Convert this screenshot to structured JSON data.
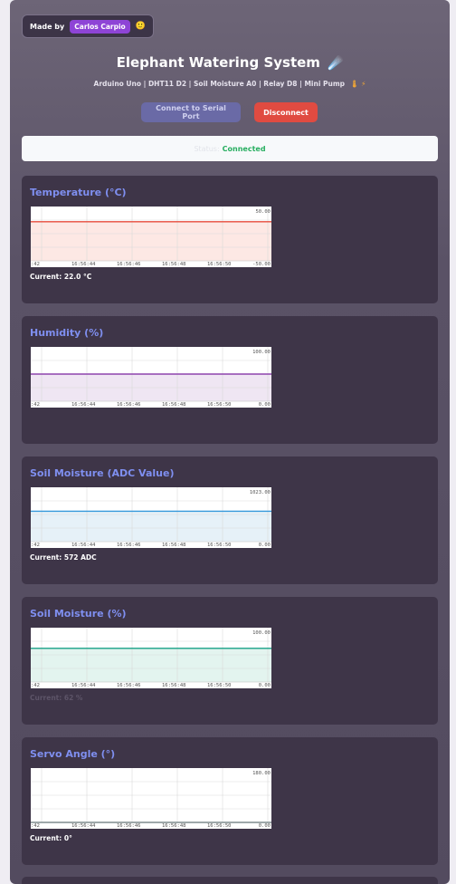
{
  "header": {
    "made_by": "Made by",
    "author": "Carlos Carpio",
    "author_icon": "🙂",
    "title": "Elephant Watering System",
    "title_icon": "☄️",
    "subtitle": "Arduino Uno | DHT11 D2 | Soil Moisture A0 | Relay D8 | Mini Pump",
    "subtitle_icons": "🌡 ⚡"
  },
  "buttons": {
    "connect": "Connect to Serial Port",
    "disconnect": "Disconnect"
  },
  "status": {
    "label": "Status:",
    "value": "Connected"
  },
  "x_ticks": [
    ":42",
    "16:56:44",
    "16:56:46",
    "16:56:48",
    "16:56:50"
  ],
  "cards": [
    {
      "title": "Temperature (°C)",
      "current": "Current: 22.0 °C",
      "current_visible": true,
      "color": "#e74c3c",
      "fill": "#fde8e4",
      "ymax_label": "50.00",
      "ymin_label": "-50.00",
      "ymin": -50,
      "ymax": 50,
      "value": 22.0
    },
    {
      "title": "Humidity (%)",
      "current": "",
      "current_visible": false,
      "color": "#8e44ad",
      "fill": "#efe6f3",
      "ymax_label": "100.00",
      "ymin_label": "0.00",
      "ymin": 0,
      "ymax": 100,
      "value": 50
    },
    {
      "title": "Soil Moisture (ADC Value)",
      "current": "Current: 572 ADC",
      "current_visible": true,
      "color": "#3498db",
      "fill": "#e6f1f8",
      "ymax_label": "1023.00",
      "ymin_label": "0.00",
      "ymin": 0,
      "ymax": 1023,
      "value": 572
    },
    {
      "title": "Soil Moisture (%)",
      "current": "Current: 62 %",
      "current_visible": false,
      "color": "#16a085",
      "fill": "#e3f4ef",
      "ymax_label": "100.00",
      "ymin_label": "0.00",
      "ymin": 0,
      "ymax": 100,
      "value": 62
    },
    {
      "title": "Servo Angle (°)",
      "current": "Current: 0°",
      "current_visible": true,
      "color": "#7f8c8d",
      "fill": "#ffffff",
      "ymax_label": "180.00",
      "ymin_label": "0.00",
      "ymin": 0,
      "ymax": 180,
      "value": 0
    }
  ]
}
